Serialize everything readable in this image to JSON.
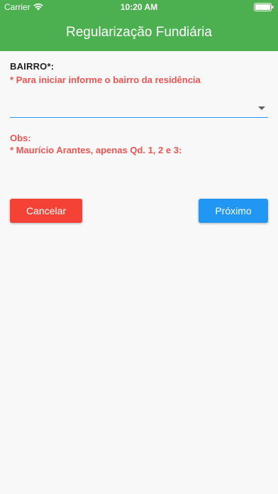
{
  "status_bar": {
    "carrier": "Carrier",
    "time": "10:20 AM"
  },
  "app_bar": {
    "title": "Regularização Fundiária"
  },
  "form": {
    "bairro_label": "BAIRRO*:",
    "bairro_hint": "* Para iniciar informe o bairro da residência",
    "bairro_value": "",
    "obs_title": "Obs:",
    "obs_text": "* Maurício Arantes, apenas Qd. 1, 2 e 3:"
  },
  "actions": {
    "cancel_label": "Cancelar",
    "next_label": "Próximo"
  },
  "colors": {
    "app_bar": "#4caf50",
    "cancel": "#f44336",
    "next": "#2196f3",
    "hint_text": "#ef5350",
    "underline": "#2196f3"
  },
  "icons": {
    "wifi": "wifi-icon",
    "battery": "battery-icon",
    "dropdown": "dropdown-arrow-icon"
  }
}
